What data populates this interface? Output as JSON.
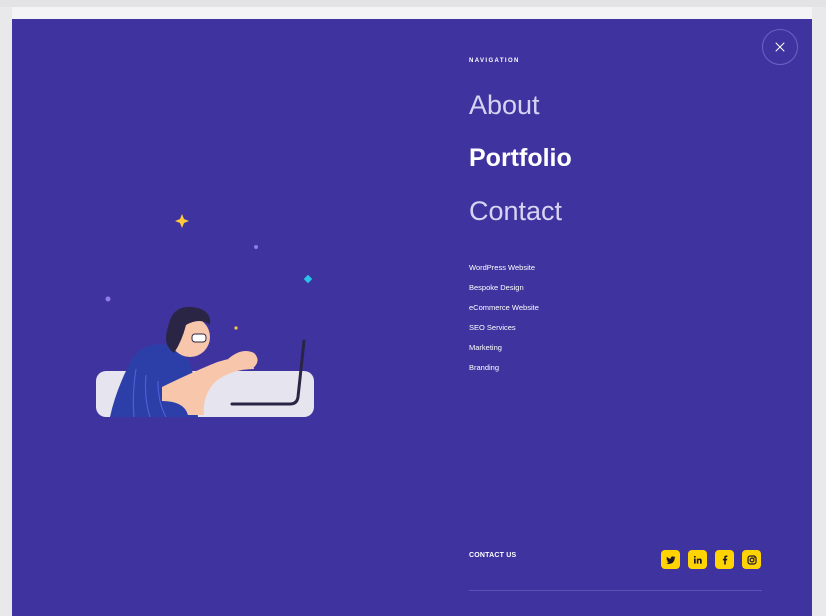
{
  "navigation": {
    "heading": "NAVIGATION",
    "primary": [
      {
        "label": "About",
        "active": false
      },
      {
        "label": "Portfolio",
        "active": true
      },
      {
        "label": "Contact",
        "active": false
      }
    ],
    "services": [
      "WordPress Website",
      "Bespoke Design",
      "eCommerce Website",
      "SEO Services",
      "Marketing",
      "Branding"
    ]
  },
  "contact": {
    "label": "CONTACT US"
  },
  "social": [
    "twitter-icon",
    "linkedin-icon",
    "facebook-icon",
    "instagram-icon"
  ],
  "colors": {
    "panel": "#3f349f",
    "accent": "#ffd400",
    "text": "#ffffff"
  }
}
